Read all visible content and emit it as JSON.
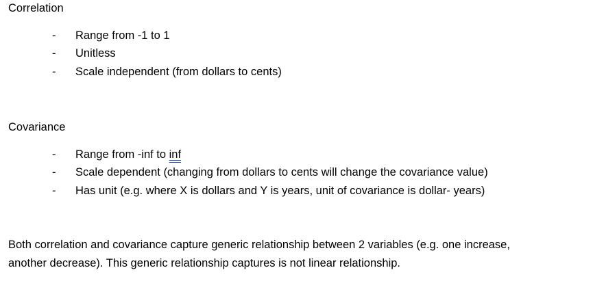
{
  "correlation": {
    "heading": "Correlation",
    "bullets": [
      {
        "dash": "-",
        "text": "Range from -1 to 1"
      },
      {
        "dash": "-",
        "text": "Unitless"
      },
      {
        "dash": "-",
        "text": "Scale independent (from dollars to cents)"
      }
    ]
  },
  "covariance": {
    "heading": "Covariance",
    "bullets": [
      {
        "dash": "-",
        "text_before": "Range from -inf to ",
        "text_flagged": "inf"
      },
      {
        "dash": "-",
        "text": "Scale dependent (changing from dollars to cents will change the covariance value)"
      },
      {
        "dash": "-",
        "text": "Has unit (e.g. where X is dollars and Y is years, unit of covariance is dollar- years)"
      }
    ]
  },
  "summary": {
    "line1": "Both correlation and covariance capture generic relationship between 2 variables (e.g. one increase,",
    "line2": "another decrease). This generic relationship captures is not linear relationship."
  },
  "colors": {
    "text": "#000000",
    "background": "#ffffff",
    "spellcheck_underline": "#1f4fb4"
  }
}
